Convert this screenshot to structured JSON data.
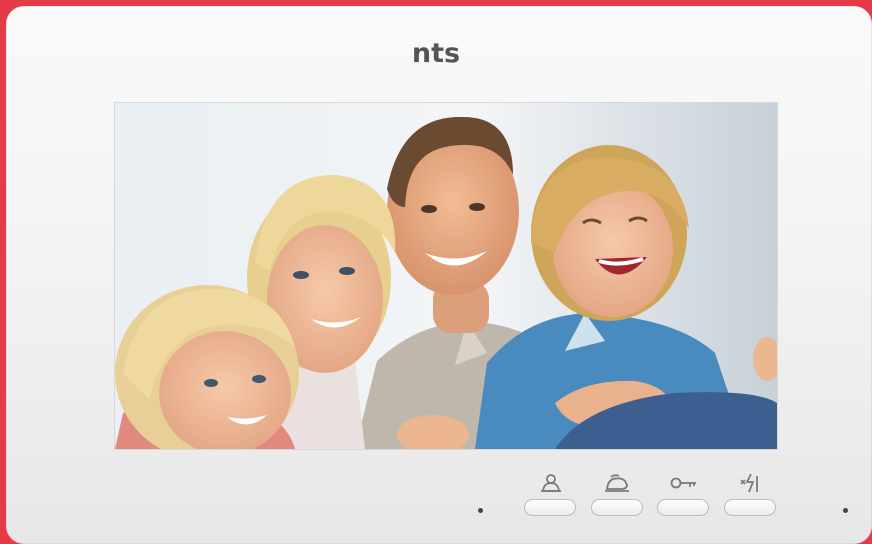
{
  "brand": {
    "logo_text": "nts"
  },
  "screen": {
    "content": "family-photo",
    "background": "#dfe6ec"
  },
  "controls": {
    "buttons": [
      {
        "icon": "intercom-icon"
      },
      {
        "icon": "monitor-camera-icon"
      },
      {
        "icon": "door-key-icon"
      },
      {
        "icon": "gate-light-icon"
      }
    ],
    "indicator_color": "#444444"
  },
  "colors": {
    "frame": "#e63a49",
    "panel": "#f3f3f3",
    "icon": "#7a7a7a"
  }
}
